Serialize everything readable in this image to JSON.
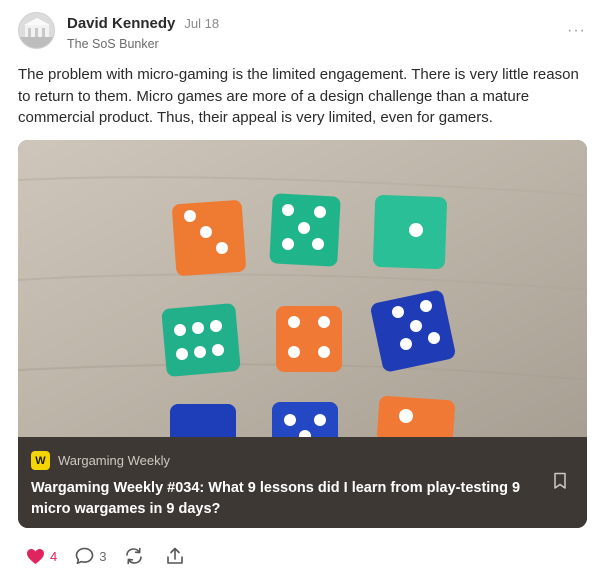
{
  "post": {
    "author": "David Kennedy",
    "date": "Jul 18",
    "publication": "The SoS Bunker",
    "more_label": "···",
    "text": "The problem with micro-gaming is the limited engagement. There is very little reason to return to them. Micro games are more of a design challenge than a mature commercial product. Thus, their appeal is very limited, even for gamers."
  },
  "embed": {
    "publication_logo": "W",
    "publication_name": "Wargaming Weekly",
    "title": "Wargaming Weekly #034: What 9 lessons did I learn from play-testing 9 micro wargames in 9 days?",
    "image_alt": "Nine dice in orange, green and blue arranged in a grid on a wooden table"
  },
  "actions": {
    "likes": "4",
    "comments": "3"
  },
  "colors": {
    "like_red": "#e0245e",
    "card_footer": "#3d3833",
    "logo_yellow": "#f5d400"
  },
  "icons": [
    "more-icon",
    "bookmark-icon",
    "heart-icon",
    "comment-icon",
    "restack-icon",
    "share-icon"
  ]
}
